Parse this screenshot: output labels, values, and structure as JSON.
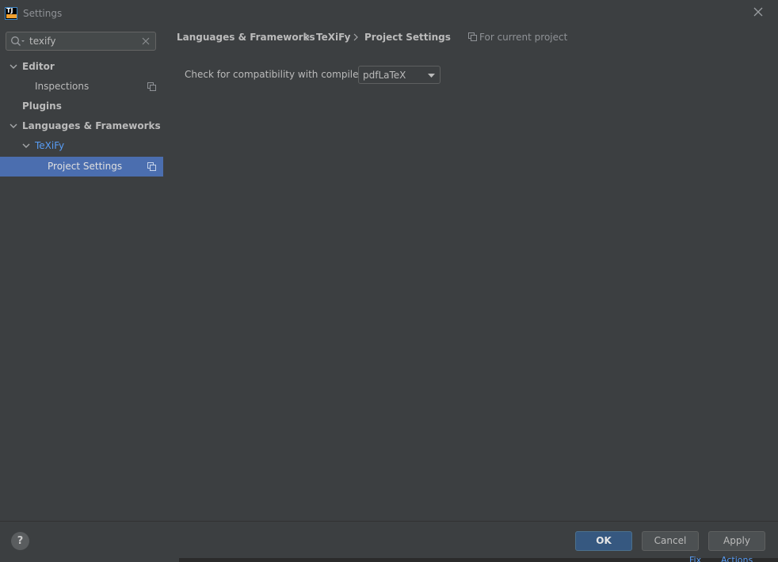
{
  "window": {
    "title": "Settings",
    "logo_text": "TJ"
  },
  "search": {
    "value": "texify",
    "placeholder": ""
  },
  "tree": {
    "items": [
      {
        "label": "Editor"
      },
      {
        "label": "Inspections"
      },
      {
        "label": "Plugins"
      },
      {
        "label": "Languages & Frameworks"
      },
      {
        "label": "TeXiFy"
      },
      {
        "label": "Project Settings"
      }
    ]
  },
  "breadcrumb": [
    "Languages & Frameworks",
    "TeXiFy",
    "Project Settings"
  ],
  "scope_label": "For current project",
  "compatibility": {
    "label": "Check for compatibility with compiler:",
    "selected": "pdfLaTeX"
  },
  "footer": {
    "help_label": "?",
    "ok_label": "OK",
    "cancel_label": "Cancel",
    "apply_label": "Apply"
  },
  "background_fragments": [
    "Fix",
    "Actions"
  ],
  "colors": {
    "background": "#3c3f41",
    "selection": "#4b6eaf",
    "link": "#589df6",
    "ok_button": "#365880"
  }
}
